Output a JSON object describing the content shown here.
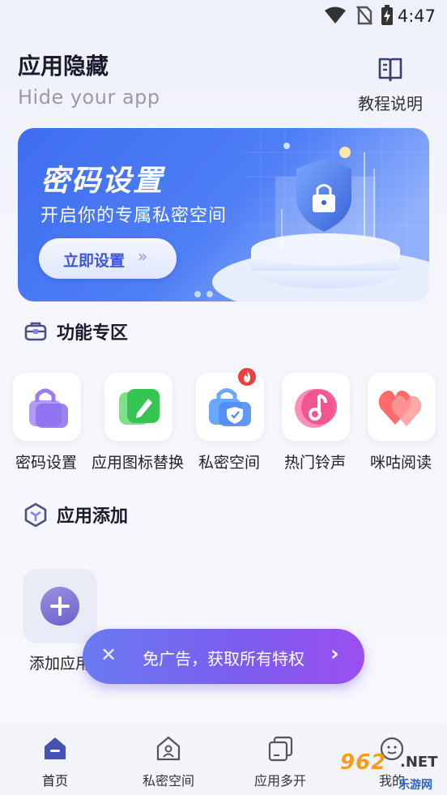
{
  "status_bar": {
    "time": "4:47"
  },
  "header": {
    "title": "应用隐藏",
    "subtitle": "Hide your app",
    "guide_label": "教程说明"
  },
  "banner": {
    "title": "密码设置",
    "subtitle": "开启你的专属私密空间",
    "cta_label": "立即设置",
    "cta_arrow": "»",
    "slides": 2,
    "active_slide": 1
  },
  "features_section": {
    "title": "功能专区"
  },
  "features": [
    {
      "label": "密码设置",
      "icon": "lock-icon",
      "color": "#9a7ef0"
    },
    {
      "label": "应用图标替换",
      "icon": "edit-icon",
      "color": "#3cc65a"
    },
    {
      "label": "私密空间",
      "icon": "shield-bag-icon",
      "color": "#4f8df5",
      "badge": "hot-fire-icon"
    },
    {
      "label": "热门铃声",
      "icon": "music-note-icon",
      "color": "#f0508a"
    },
    {
      "label": "咪咕阅读",
      "icon": "heart-icon",
      "color": "#f04848"
    }
  ],
  "apps_section": {
    "title": "应用添加",
    "add_label": "添加应用"
  },
  "promo": {
    "text": "免广告，获取所有特权",
    "close": "✕",
    "chevron": "›"
  },
  "tabbar": [
    {
      "label": "首页",
      "icon": "home-icon",
      "active": true
    },
    {
      "label": "私密空间",
      "icon": "private-home-icon",
      "active": false
    },
    {
      "label": "应用多开",
      "icon": "multi-open-icon",
      "active": false
    },
    {
      "label": "我的",
      "icon": "profile-icon",
      "active": false
    }
  ],
  "watermark": {
    "brand": "962",
    "net": ".NET",
    "site": "乐游网"
  }
}
